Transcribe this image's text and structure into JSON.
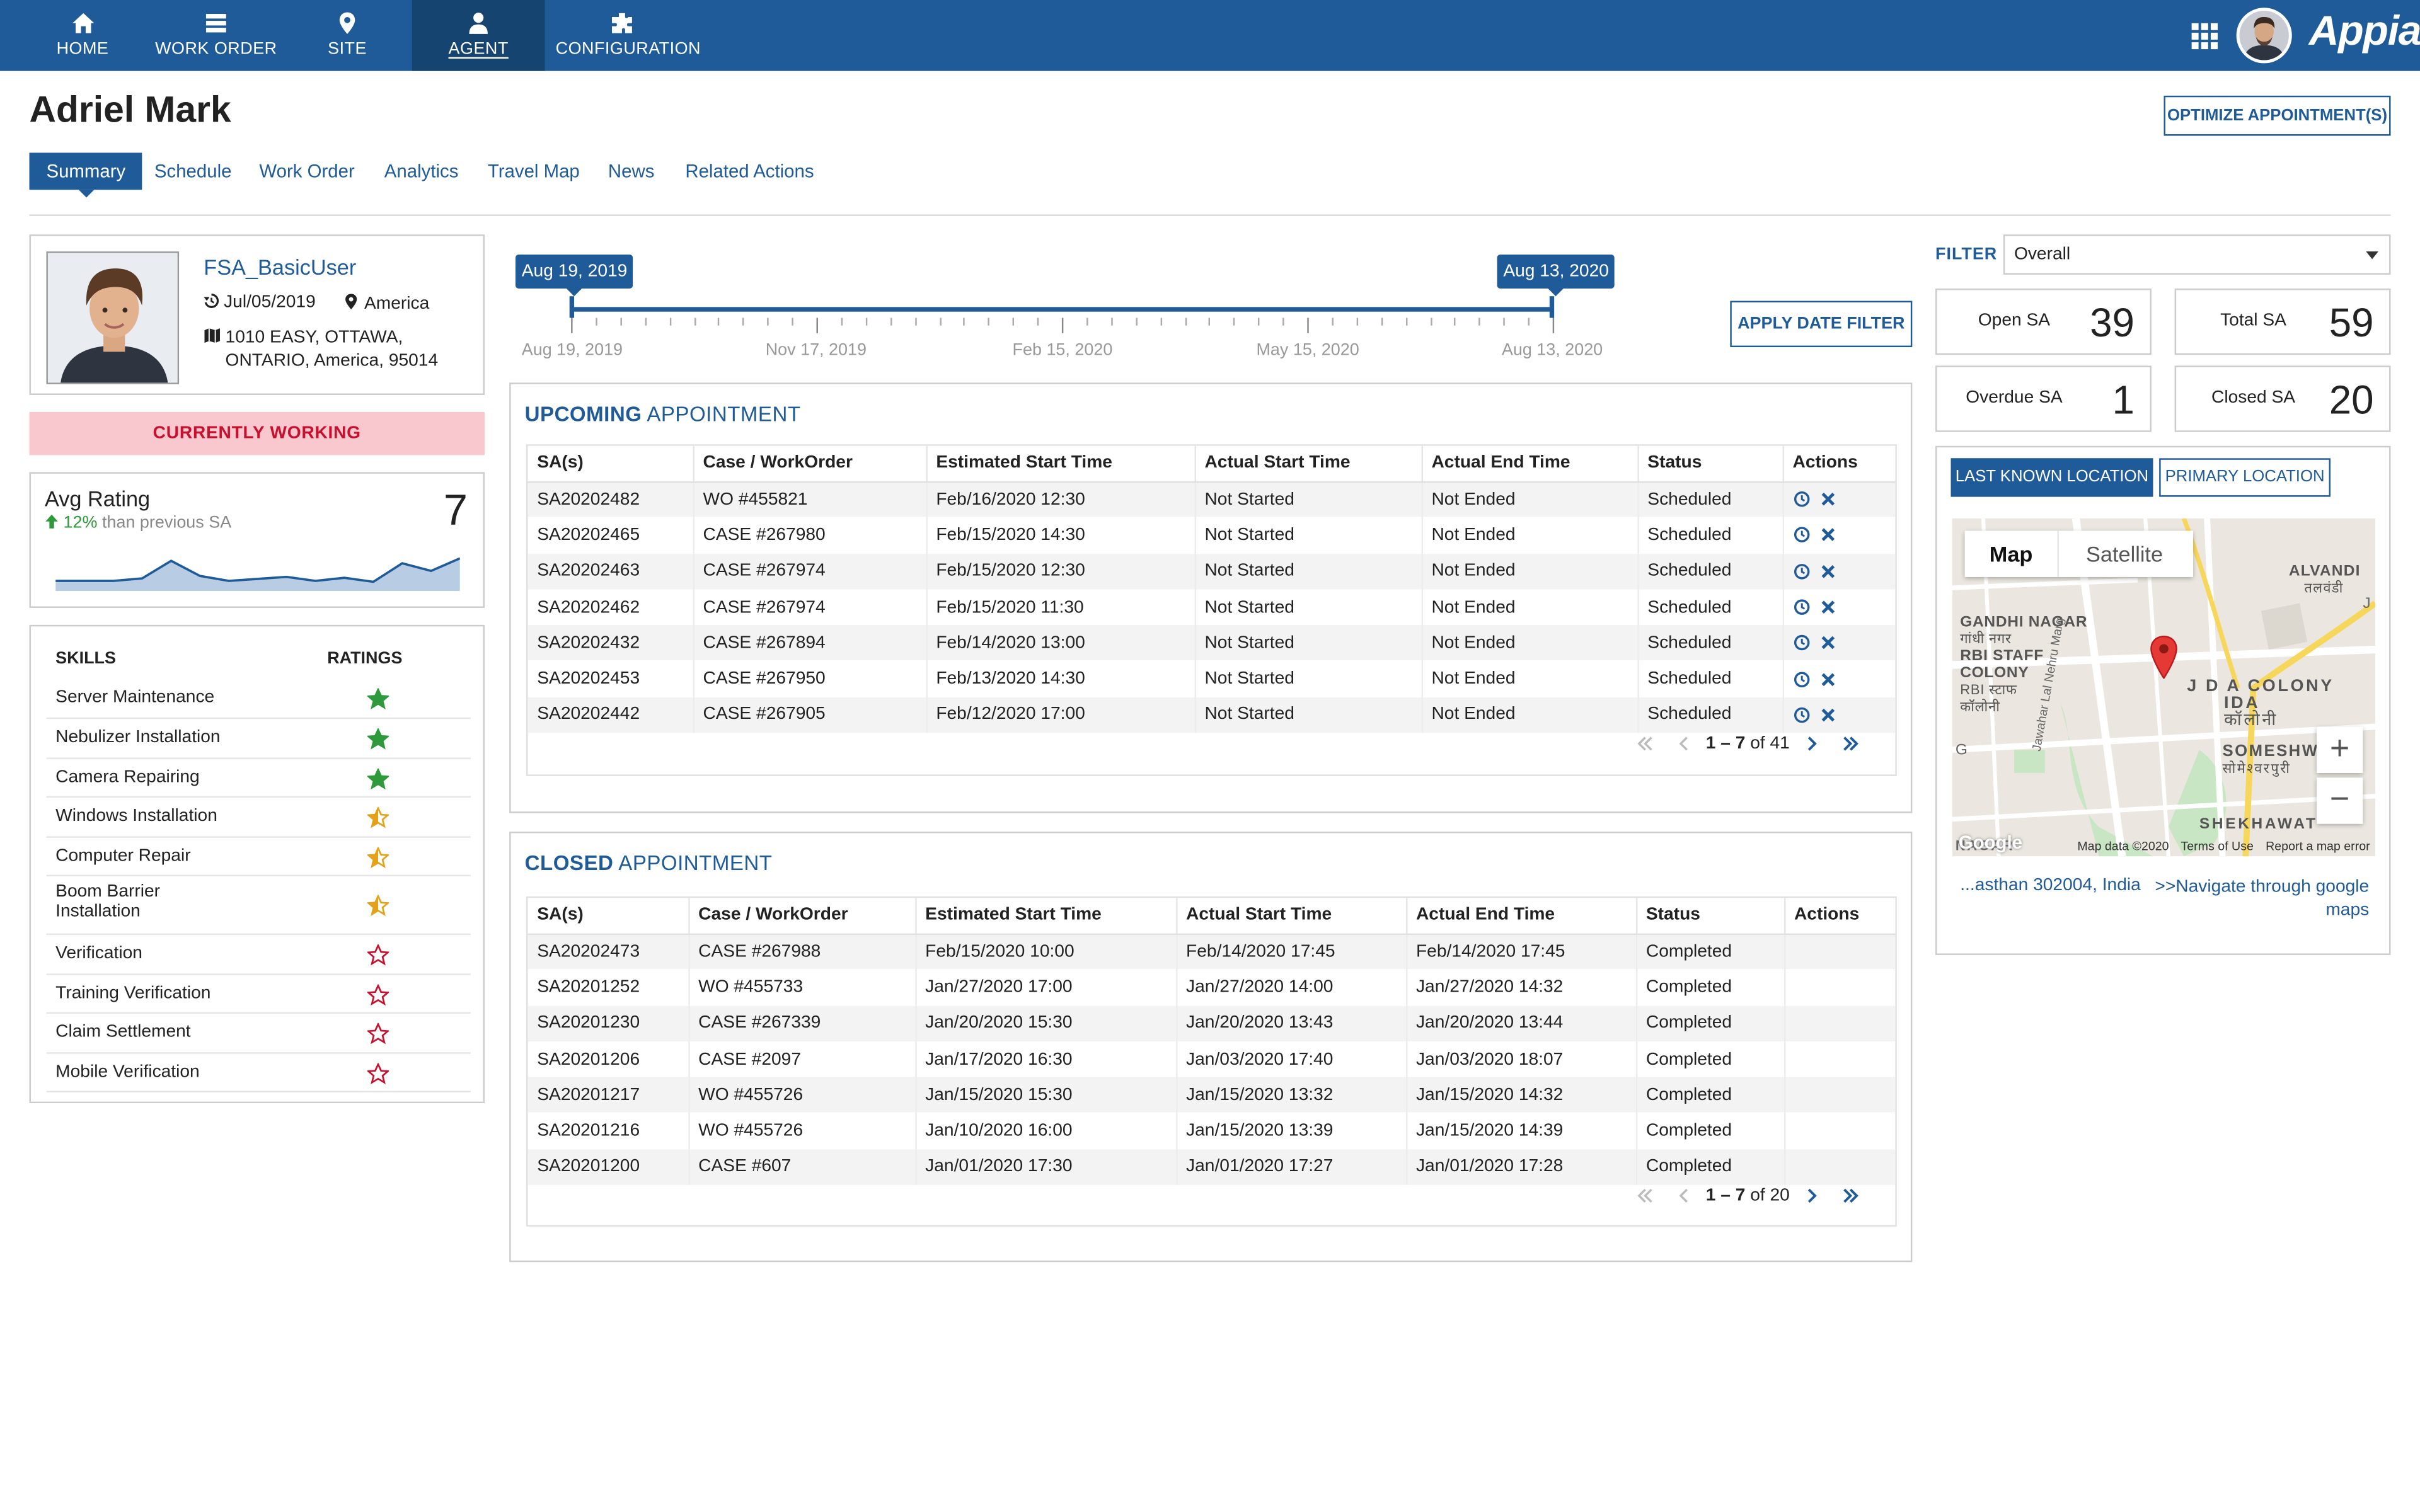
{
  "app": {
    "brand": "Appian"
  },
  "nav": [
    {
      "label": "HOME",
      "icon": "home-icon"
    },
    {
      "label": "WORK ORDER",
      "icon": "list-icon"
    },
    {
      "label": "SITE",
      "icon": "map-pin-icon"
    },
    {
      "label": "AGENT",
      "icon": "user-icon",
      "active": true
    },
    {
      "label": "CONFIGURATION",
      "icon": "puzzle-icon"
    }
  ],
  "page": {
    "title": "Adriel Mark",
    "optimize_label": "OPTIMIZE APPOINTMENT(S)"
  },
  "tabs": [
    "Summary",
    "Schedule",
    "Work Order",
    "Analytics",
    "Travel Map",
    "News",
    "Related Actions"
  ],
  "profile": {
    "username": "FSA_BasicUser",
    "date": "Jul/05/2019",
    "region": "America",
    "address_line1": "1010 EASY, OTTAWA,",
    "address_line2": "ONTARIO, America, 95014",
    "status": "CURRENTLY WORKING"
  },
  "rating": {
    "title": "Avg Rating",
    "change": "12%",
    "change_text": "than previous SA",
    "value": "7",
    "trend": [
      2,
      2,
      2,
      2.5,
      6,
      3,
      2,
      2.4,
      2.8,
      2,
      2.6,
      1.8,
      5.5,
      4,
      6.5
    ]
  },
  "skills": {
    "header_skill": "SKILLS",
    "header_rating": "RATINGS",
    "items": [
      {
        "name": "Server Maintenance",
        "rating": "full"
      },
      {
        "name": "Nebulizer Installation",
        "rating": "full"
      },
      {
        "name": "Camera Repairing",
        "rating": "full"
      },
      {
        "name": "Windows Installation",
        "rating": "half"
      },
      {
        "name": "Computer Repair",
        "rating": "half"
      },
      {
        "name": "Boom Barrier Installation",
        "rating": "half"
      },
      {
        "name": "Verification",
        "rating": "empty"
      },
      {
        "name": "Training Verification",
        "rating": "empty"
      },
      {
        "name": "Claim Settlement",
        "rating": "empty"
      },
      {
        "name": "Mobile Verification",
        "rating": "empty"
      }
    ]
  },
  "timeline": {
    "start_flag": "Aug 19, 2019",
    "end_flag": "Aug 13, 2020",
    "labels": [
      "Aug 19, 2019",
      "Nov 17, 2019",
      "Feb 15, 2020",
      "May 15, 2020",
      "Aug 13, 2020"
    ],
    "apply_label": "APPLY DATE FILTER"
  },
  "upcoming": {
    "title_bold": "UPCOMING",
    "title_rest": "APPOINTMENT",
    "columns": [
      "SA(s)",
      "Case / WorkOrder",
      "Estimated Start Time",
      "Actual Start Time",
      "Actual End Time",
      "Status",
      "Actions"
    ],
    "rows": [
      [
        "SA20202482",
        "WO #455821",
        "Feb/16/2020 12:30",
        "Not Started",
        "Not Ended",
        "Scheduled"
      ],
      [
        "SA20202465",
        "CASE #267980",
        "Feb/15/2020 14:30",
        "Not Started",
        "Not Ended",
        "Scheduled"
      ],
      [
        "SA20202463",
        "CASE #267974",
        "Feb/15/2020 12:30",
        "Not Started",
        "Not Ended",
        "Scheduled"
      ],
      [
        "SA20202462",
        "CASE #267974",
        "Feb/15/2020 11:30",
        "Not Started",
        "Not Ended",
        "Scheduled"
      ],
      [
        "SA20202432",
        "CASE #267894",
        "Feb/14/2020 13:00",
        "Not Started",
        "Not Ended",
        "Scheduled"
      ],
      [
        "SA20202453",
        "CASE #267950",
        "Feb/13/2020 14:30",
        "Not Started",
        "Not Ended",
        "Scheduled"
      ],
      [
        "SA20202442",
        "CASE #267905",
        "Feb/12/2020 17:00",
        "Not Started",
        "Not Ended",
        "Scheduled"
      ]
    ],
    "pager_range": "1 – 7",
    "pager_total": "of 41"
  },
  "closed": {
    "title_bold": "CLOSED",
    "title_rest": "APPOINTMENT",
    "columns": [
      "SA(s)",
      "Case / WorkOrder",
      "Estimated Start Time",
      "Actual Start Time",
      "Actual End Time",
      "Status",
      "Actions"
    ],
    "rows": [
      [
        "SA20202473",
        "CASE #267988",
        "Feb/15/2020 10:00",
        "Feb/14/2020 17:45",
        "Feb/14/2020 17:45",
        "Completed",
        ""
      ],
      [
        "SA20201252",
        "WO #455733",
        "Jan/27/2020 17:00",
        "Jan/27/2020 14:00",
        "Jan/27/2020 14:32",
        "Completed",
        ""
      ],
      [
        "SA20201230",
        "CASE #267339",
        "Jan/20/2020 15:30",
        "Jan/20/2020 13:43",
        "Jan/20/2020 13:44",
        "Completed",
        ""
      ],
      [
        "SA20201206",
        "CASE #2097",
        "Jan/17/2020 16:30",
        "Jan/03/2020 17:40",
        "Jan/03/2020 18:07",
        "Completed",
        ""
      ],
      [
        "SA20201217",
        "WO #455726",
        "Jan/15/2020 15:30",
        "Jan/15/2020 13:32",
        "Jan/15/2020 14:32",
        "Completed",
        ""
      ],
      [
        "SA20201216",
        "WO #455726",
        "Jan/10/2020 16:00",
        "Jan/15/2020 13:39",
        "Jan/15/2020 14:39",
        "Completed",
        ""
      ],
      [
        "SA20201200",
        "CASE #607",
        "Jan/01/2020 17:30",
        "Jan/01/2020 17:27",
        "Jan/01/2020 17:28",
        "Completed",
        ""
      ]
    ],
    "pager_range": "1 – 7",
    "pager_total": "of 20"
  },
  "filter": {
    "label": "FILTER",
    "value": "Overall"
  },
  "stats": {
    "open": {
      "label": "Open SA",
      "value": "39"
    },
    "total": {
      "label": "Total SA",
      "value": "59"
    },
    "overdue": {
      "label": "Overdue SA",
      "value": "1"
    },
    "closed": {
      "label": "Closed SA",
      "value": "20"
    }
  },
  "location": {
    "last_known": "LAST KNOWN LOCATION",
    "primary": "PRIMARY LOCATION",
    "map_tab": "Map",
    "satellite_tab": "Satellite",
    "map_labels": [
      "GANDHI NAGAR",
      "गांधी नगर",
      "RBI STAFF",
      "COLONY",
      "RBI स्टाफ",
      "कॉलोनी",
      "J D A COLONY",
      "IDA",
      "कॉलोनी",
      "SOMESHWARP",
      "सोमेश्वरपुरी",
      "ALVANDI",
      "तलवंडी",
      "SHEKHAWAT",
      "NAGAR",
      "Jawahar Lal Nehru Marg",
      "G",
      "J"
    ],
    "zoom_in": "+",
    "zoom_out": "−",
    "google": "Google",
    "map_data": "Map data ©2020",
    "terms": "Terms of Use",
    "report": "Report a map error",
    "address": "...asthan 302004, India",
    "navigate": ">>Navigate through google maps"
  }
}
